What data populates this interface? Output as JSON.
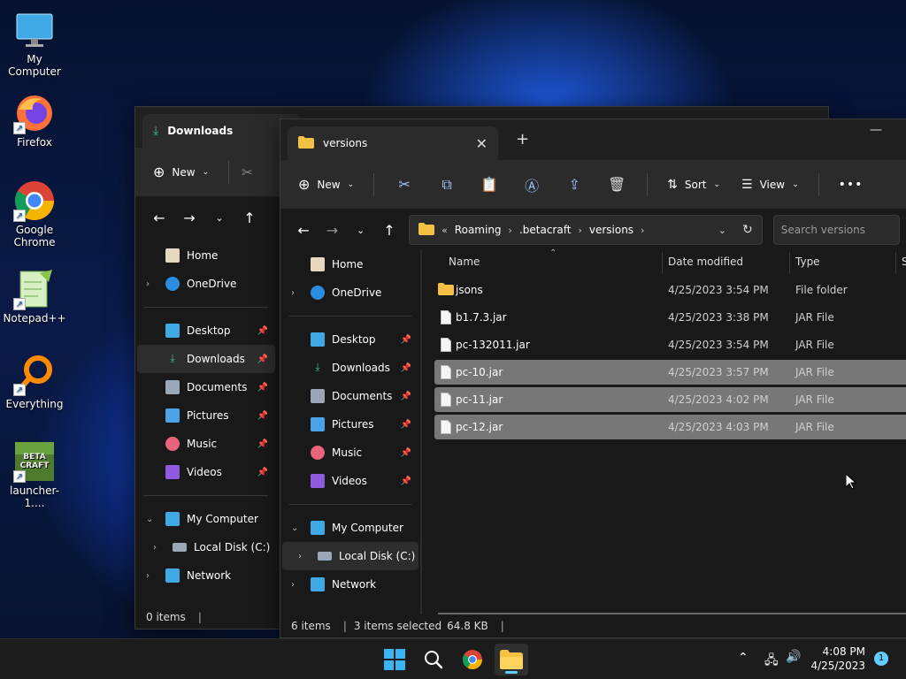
{
  "desktop": {
    "icons": [
      {
        "label": "My Computer",
        "icon": "monitor-icon"
      },
      {
        "label": "Firefox",
        "icon": "firefox-icon"
      },
      {
        "label": "Google Chrome",
        "icon": "chrome-icon"
      },
      {
        "label": "Notepad++",
        "icon": "notepad-plus-plus-icon"
      },
      {
        "label": "Everything",
        "icon": "everything-search-icon"
      },
      {
        "label": "launcher-1....",
        "icon": "betacraft-icon"
      }
    ],
    "shortcut_arrow": "↗",
    "betacraft_logo_text": "BETA CRAFT"
  },
  "back_window": {
    "tab_title": "Downloads",
    "toolbar": {
      "new_label": "New"
    },
    "nav": {
      "home": "Home",
      "onedrive": "OneDrive",
      "desktop": "Desktop",
      "downloads": "Downloads",
      "documents": "Documents",
      "pictures": "Pictures",
      "music": "Music",
      "videos": "Videos",
      "my_computer": "My Computer",
      "local_disk": "Local Disk (C:)",
      "network": "Network"
    },
    "status": {
      "items": "0 items"
    }
  },
  "front_window": {
    "tab_title": "versions",
    "toolbar": {
      "new_label": "New",
      "sort_label": "Sort",
      "view_label": "View",
      "more_label": "•••"
    },
    "address": {
      "overflow": "«",
      "crumbs": [
        "Roaming",
        ".betacraft",
        "versions"
      ]
    },
    "search": {
      "placeholder": "Search versions"
    },
    "nav": {
      "home": "Home",
      "onedrive": "OneDrive",
      "desktop": "Desktop",
      "downloads": "Downloads",
      "documents": "Documents",
      "pictures": "Pictures",
      "music": "Music",
      "videos": "Videos",
      "my_computer": "My Computer",
      "local_disk": "Local Disk (C:)",
      "network": "Network"
    },
    "columns": {
      "name": "Name",
      "date": "Date modified",
      "type": "Type",
      "size": "S"
    },
    "files": [
      {
        "name": "jsons",
        "date": "4/25/2023 3:54 PM",
        "type": "File folder",
        "kind": "folder",
        "selected": false
      },
      {
        "name": "b1.7.3.jar",
        "date": "4/25/2023 3:38 PM",
        "type": "JAR File",
        "kind": "file",
        "selected": false
      },
      {
        "name": "pc-132011.jar",
        "date": "4/25/2023 3:54 PM",
        "type": "JAR File",
        "kind": "file",
        "selected": false
      },
      {
        "name": "pc-10.jar",
        "date": "4/25/2023 3:57 PM",
        "type": "JAR File",
        "kind": "file",
        "selected": true
      },
      {
        "name": "pc-11.jar",
        "date": "4/25/2023 4:02 PM",
        "type": "JAR File",
        "kind": "file",
        "selected": true
      },
      {
        "name": "pc-12.jar",
        "date": "4/25/2023 4:03 PM",
        "type": "JAR File",
        "kind": "file",
        "selected": true
      }
    ],
    "status": {
      "items": "6 items",
      "selected": "3 items selected",
      "size": "64.8 KB"
    }
  },
  "taskbar": {
    "time": "4:08 PM",
    "date": "4/25/2023",
    "notification_count": "1"
  },
  "colors": {
    "accent": "#60cdff",
    "selection": "#777777",
    "folder": "#f4c145",
    "download_green": "#3fbf8a"
  }
}
